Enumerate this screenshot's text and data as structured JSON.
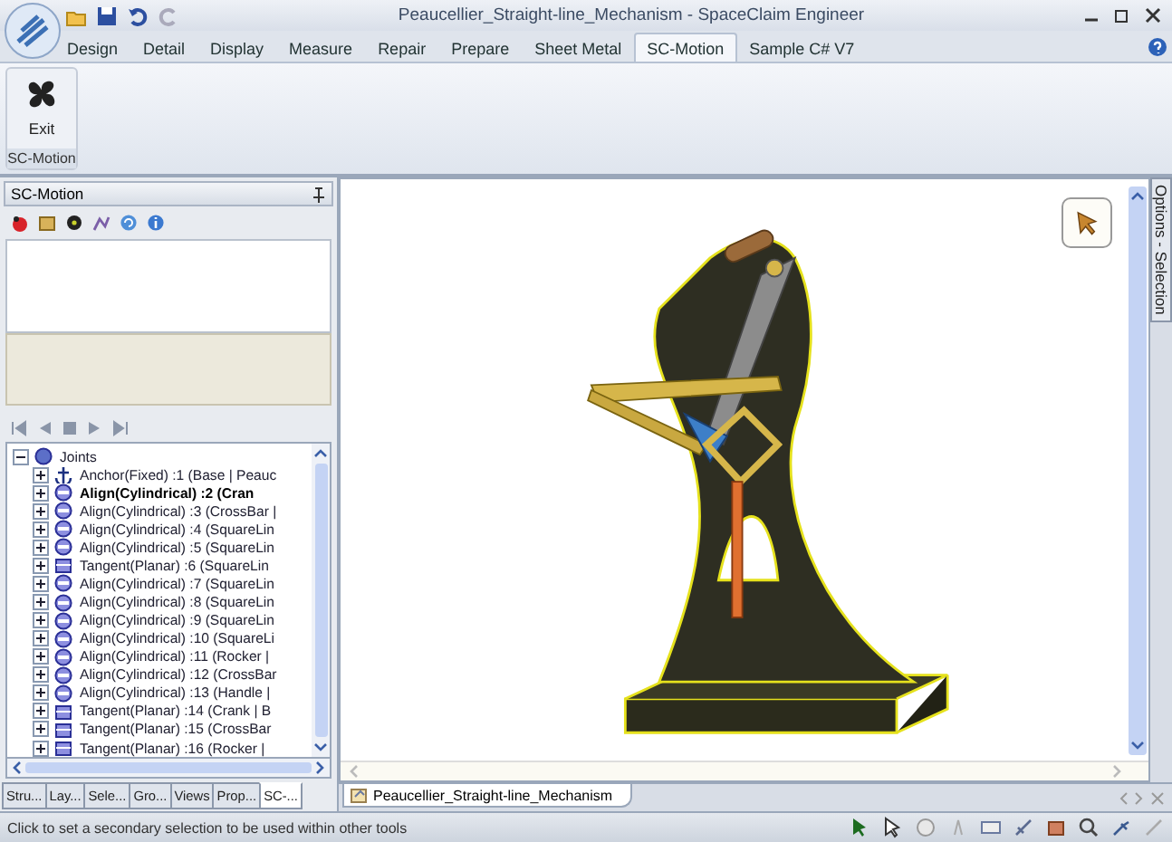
{
  "window": {
    "title": "Peaucellier_Straight-line_Mechanism - SpaceClaim Engineer"
  },
  "ribbon": {
    "tabs": [
      {
        "label": "Design",
        "selected": false
      },
      {
        "label": "Detail",
        "selected": false
      },
      {
        "label": "Display",
        "selected": false
      },
      {
        "label": "Measure",
        "selected": false
      },
      {
        "label": "Repair",
        "selected": false
      },
      {
        "label": "Prepare",
        "selected": false
      },
      {
        "label": "Sheet Metal",
        "selected": false
      },
      {
        "label": "SC-Motion",
        "selected": true
      },
      {
        "label": "Sample C# V7",
        "selected": false
      }
    ],
    "group": {
      "button": "Exit",
      "label": "SC-Motion"
    }
  },
  "side_panel": {
    "title": "SC-Motion",
    "tree": {
      "label": "Joints",
      "expanded": true,
      "children": [
        {
          "kind": "anchor",
          "label": "Anchor(Fixed) :1 (Base | Peauc",
          "selected": false,
          "expanded": false
        },
        {
          "kind": "align",
          "label": "Align(Cylindrical) :2 (Cran",
          "selected": true,
          "expanded": false
        },
        {
          "kind": "align",
          "label": "Align(Cylindrical) :3 (CrossBar |",
          "selected": false,
          "expanded": false
        },
        {
          "kind": "align",
          "label": "Align(Cylindrical) :4 (SquareLin",
          "selected": false,
          "expanded": false
        },
        {
          "kind": "align",
          "label": "Align(Cylindrical) :5 (SquareLin",
          "selected": false,
          "expanded": false
        },
        {
          "kind": "tangent",
          "label": "Tangent(Planar) :6 (SquareLin",
          "selected": false,
          "expanded": false
        },
        {
          "kind": "align",
          "label": "Align(Cylindrical) :7 (SquareLin",
          "selected": false,
          "expanded": false
        },
        {
          "kind": "align",
          "label": "Align(Cylindrical) :8 (SquareLin",
          "selected": false,
          "expanded": false
        },
        {
          "kind": "align",
          "label": "Align(Cylindrical) :9 (SquareLin",
          "selected": false,
          "expanded": false
        },
        {
          "kind": "align",
          "label": "Align(Cylindrical) :10 (SquareLi",
          "selected": false,
          "expanded": false
        },
        {
          "kind": "align",
          "label": "Align(Cylindrical) :11 (Rocker |",
          "selected": false,
          "expanded": false
        },
        {
          "kind": "align",
          "label": "Align(Cylindrical) :12 (CrossBar",
          "selected": false,
          "expanded": false
        },
        {
          "kind": "align",
          "label": "Align(Cylindrical) :13 (Handle |",
          "selected": false,
          "expanded": false
        },
        {
          "kind": "tangent",
          "label": "Tangent(Planar) :14 (Crank | B",
          "selected": false,
          "expanded": false
        },
        {
          "kind": "tangent",
          "label": "Tangent(Planar) :15 (CrossBar",
          "selected": false,
          "expanded": false
        },
        {
          "kind": "tangent",
          "label": "Tangent(Planar) :16 (Rocker |",
          "selected": false,
          "expanded": false
        }
      ]
    },
    "tabs": [
      {
        "label": "Stru...",
        "selected": false
      },
      {
        "label": "Lay...",
        "selected": false
      },
      {
        "label": "Sele...",
        "selected": false
      },
      {
        "label": "Gro...",
        "selected": false
      },
      {
        "label": "Views",
        "selected": false
      },
      {
        "label": "Prop...",
        "selected": false
      },
      {
        "label": "SC-...",
        "selected": true
      }
    ]
  },
  "viewport": {
    "side_tab": "Options - Selection"
  },
  "document_tabs": [
    {
      "label": "Peaucellier_Straight-line_Mechanism",
      "selected": true
    }
  ],
  "status_bar": {
    "message": "Click to set a secondary selection to be used within other tools"
  }
}
